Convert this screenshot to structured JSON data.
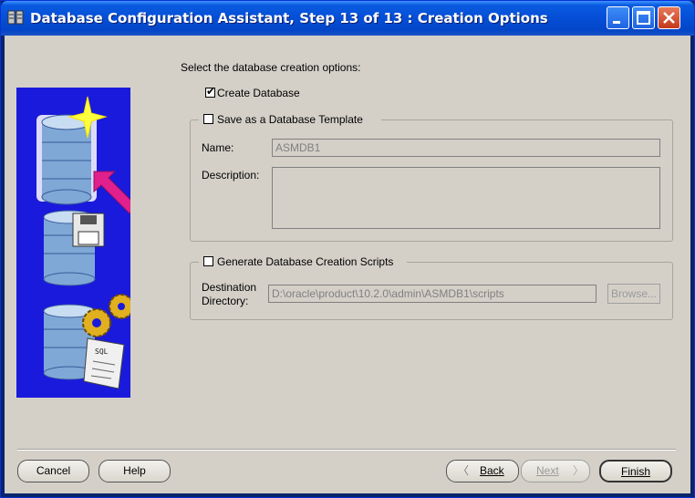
{
  "window": {
    "title": "Database Configuration Assistant, Step 13 of 13 : Creation Options"
  },
  "main": {
    "instruction": "Select the database creation options:",
    "create_database": {
      "label": "Create Database",
      "checked": true
    },
    "template_group": {
      "label": "Save as a Database Template",
      "checked": false,
      "name_label": "Name:",
      "name_value": "ASMDB1",
      "description_label": "Description:",
      "description_value": ""
    },
    "scripts_group": {
      "label": "Generate Database Creation Scripts",
      "checked": false,
      "destination_label_line1": "Destination",
      "destination_label_line2": "Directory:",
      "destination_value": "D:\\oracle\\product\\10.2.0\\admin\\ASMDB1\\scripts",
      "browse_label": "Browse..."
    }
  },
  "footer": {
    "cancel_label": "Cancel",
    "help_label": "Help",
    "back_label": "Back",
    "next_label": "Next",
    "finish_label": "Finish"
  },
  "illustration": {
    "sql_tag": "SQL"
  },
  "colors": {
    "title_bar": "#0550d8",
    "client_bg": "#d4d0c8",
    "illustration_bg": "#1a1adc",
    "arrow": "#e0208c"
  }
}
